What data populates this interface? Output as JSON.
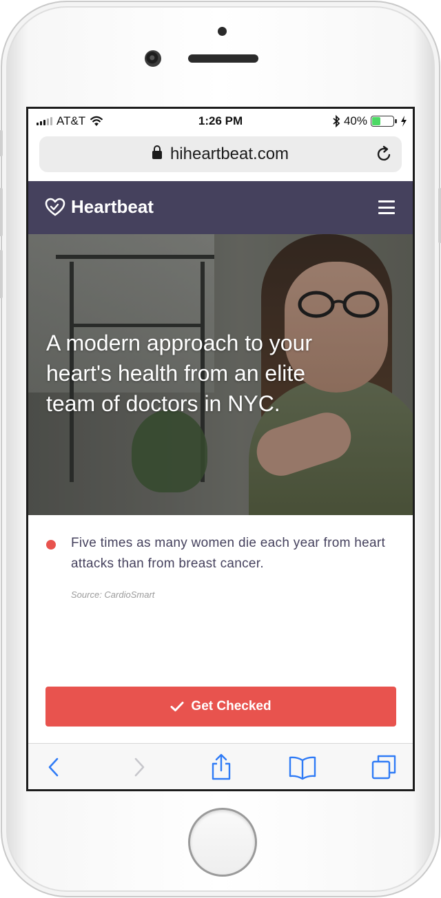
{
  "status_bar": {
    "carrier": "AT&T",
    "time": "1:26 PM",
    "battery_percent": "40%",
    "battery_level": 0.4
  },
  "browser": {
    "url": "hiheartbeat.com"
  },
  "site": {
    "brand": "Heartbeat",
    "header_color": "#45415d"
  },
  "hero": {
    "headline": "A modern approach to your heart's health from an elite team of doctors in NYC."
  },
  "stat": {
    "text": "Five times as many women die each year from heart attacks than from breast cancer.",
    "source": "Source: CardioSmart",
    "bullet_color": "#e8534e"
  },
  "cta": {
    "label": "Get Checked",
    "color": "#e8534e"
  },
  "toolbar": {
    "icons": [
      "back-icon",
      "forward-icon",
      "share-icon",
      "bookmarks-icon",
      "tabs-icon"
    ]
  }
}
